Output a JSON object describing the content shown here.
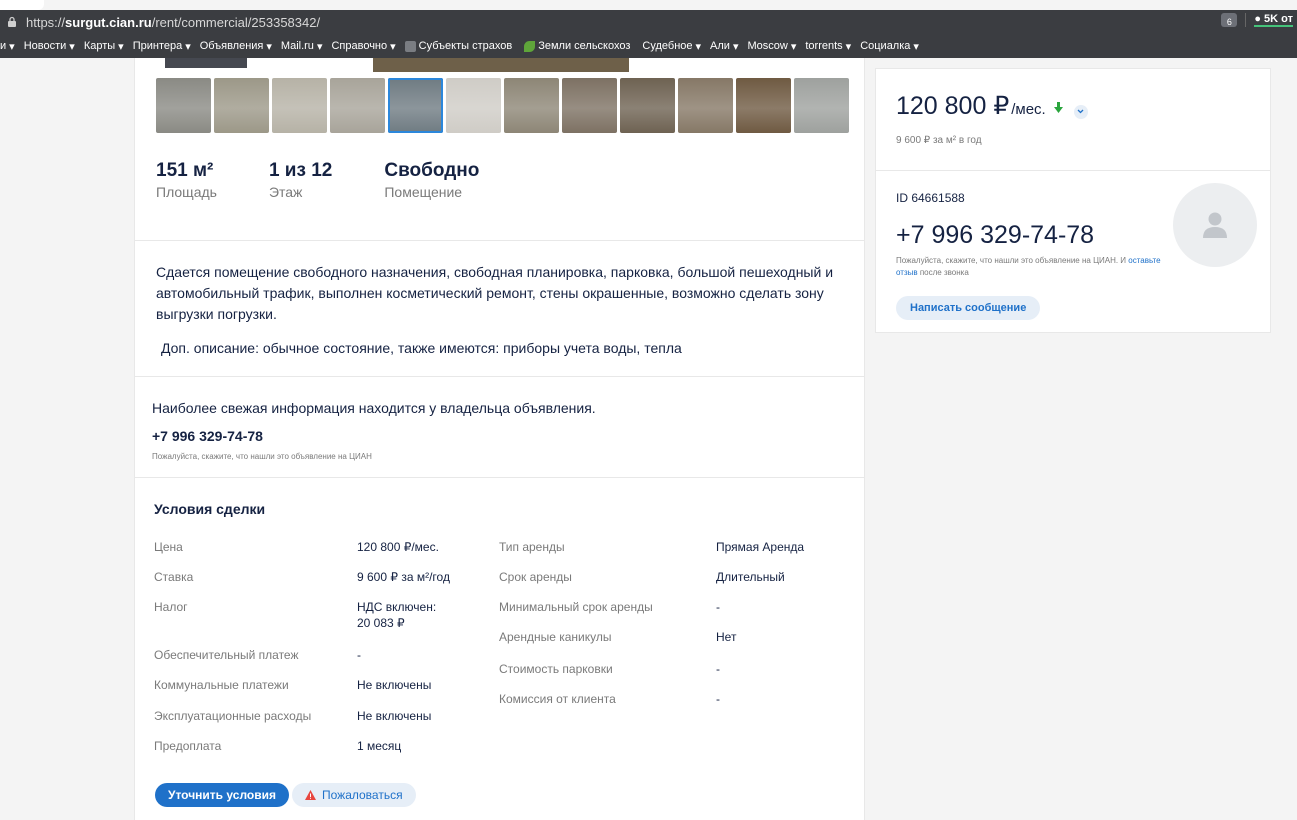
{
  "browser": {
    "url_prefix": "https://",
    "url_host": "surgut.cian.ru",
    "url_path": "/rent/commercial/253358342/",
    "ext_count": "6",
    "badge": "5K от"
  },
  "bookmarks": [
    {
      "label": "и",
      "arrow": "▾"
    },
    {
      "label": "Новости",
      "arrow": "▾"
    },
    {
      "label": "Карты",
      "arrow": "▾"
    },
    {
      "label": "Принтера",
      "arrow": "▾"
    },
    {
      "label": "Объявления",
      "arrow": "▾"
    },
    {
      "label": "Mail.ru",
      "arrow": "▾"
    },
    {
      "label": "Справочно",
      "arrow": "▾"
    },
    {
      "label": "Субъекты страхов",
      "arrow": ""
    },
    {
      "label": "Земли сельскохоз",
      "arrow": ""
    },
    {
      "label": "Судебное",
      "arrow": "▾"
    },
    {
      "label": "Али",
      "arrow": "▾"
    },
    {
      "label": "Moscow",
      "arrow": "▾"
    },
    {
      "label": "torrents",
      "arrow": "▾"
    },
    {
      "label": "Социалка",
      "arrow": "▾"
    }
  ],
  "gallery": {
    "thumb_colors": [
      "#8a8a84",
      "#9c9888",
      "#b6b2a6",
      "#a8a49a",
      "#6f7b82",
      "#cfccc6",
      "#8d8676",
      "#7d7163",
      "#6e6252",
      "#867866",
      "#6f5a42",
      "#9ea19e"
    ],
    "selected_index": 4
  },
  "facts": [
    {
      "value": "151 м²",
      "label": "Площадь"
    },
    {
      "value": "1 из 12",
      "label": "Этаж"
    },
    {
      "value": "Свободно",
      "label": "Помещение"
    }
  ],
  "description": {
    "text": "Сдается помещение свободного назначения, свободная планировка, парковка, большой пешеходный и автомобильный трафик, выполнен косметический ремонт, стены окрашенные, возможно сделать зону выгрузки погрузки.",
    "extra": "Доп. описание: обычное состояние, также имеются: приборы учета воды, тепла"
  },
  "owner": {
    "note": "Наиболее свежая информация находится у владельца объявления.",
    "phone": "+7 996 329-74-78",
    "hint": "Пожалуйста, скажите, что нашли это объявление на ЦИАН"
  },
  "terms": {
    "title": "Условия сделки",
    "left": [
      {
        "label": "Цена",
        "value": "120 800 ₽/мес."
      },
      {
        "label": "Ставка",
        "value": "9 600 ₽ за м²/год"
      },
      {
        "label": "Налог",
        "value": "НДС включен:",
        "value2": "20 083 ₽"
      },
      {
        "label": "Обеспечительный платеж",
        "value": "-"
      },
      {
        "label": "Коммунальные платежи",
        "value": "Не включены"
      },
      {
        "label": "Эксплуатационные расходы",
        "value": "Не включены"
      },
      {
        "label": "Предоплата",
        "value": "1 месяц"
      }
    ],
    "right": [
      {
        "label": "Тип аренды",
        "value": "Прямая Аренда"
      },
      {
        "label": "Срок аренды",
        "value": "Длительный"
      },
      {
        "label": "Минимальный срок аренды",
        "value": "-"
      },
      {
        "label": "Арендные каникулы",
        "value": "Нет"
      },
      {
        "label": "Стоимость парковки",
        "value": "-"
      },
      {
        "label": "Комиссия от клиента",
        "value": "-"
      }
    ],
    "clarify_button": "Уточнить условия",
    "complain_button": "Пожаловаться"
  },
  "price_card": {
    "price": "120 800 ₽",
    "unit": "/мес.",
    "per_meter": "9 600 ₽ за м² в год"
  },
  "agent": {
    "id_label": "ID 64661588",
    "phone": "+7 996 329-74-78",
    "hint_before": "Пожалуйста, скажите, что нашли это объявление на ЦИАН. И ",
    "hint_link": "оставьте отзыв",
    "hint_after": " после звонка",
    "message_button": "Написать сообщение"
  },
  "colors": {
    "accent": "#1f71c9",
    "text": "#152242",
    "muted": "#7a7a7a",
    "green": "#2aa53d"
  }
}
